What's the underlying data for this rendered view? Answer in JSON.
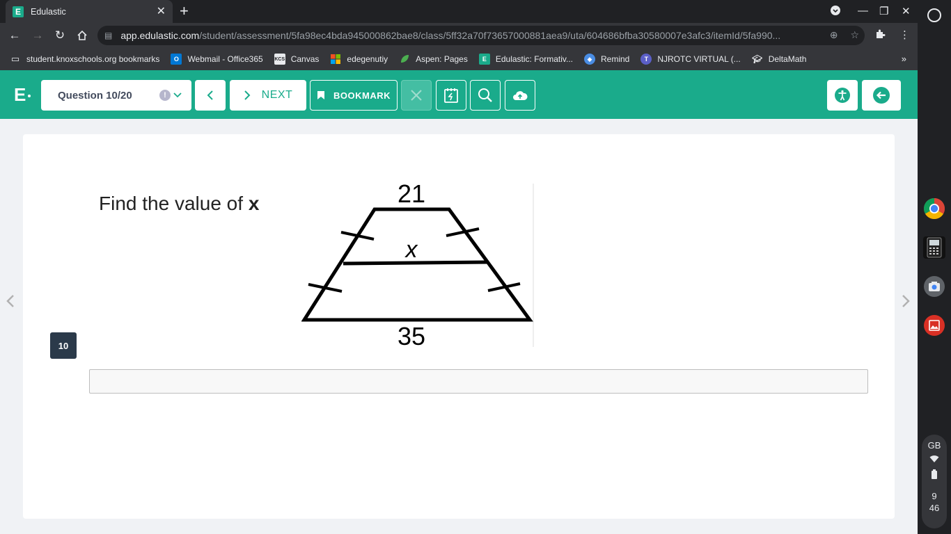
{
  "browser": {
    "tab_title": "Edulastic",
    "tab_favicon_letter": "E",
    "url_host": "app.edulastic.com",
    "url_path": "/student/assessment/5fa98ec4bda945000862bae8/class/5ff32a70f73657000881aea9/uta/604686bfba30580007e3afc3/itemId/5fa990..."
  },
  "bookmarks": [
    {
      "label": "student.knoxschools.org bookmarks",
      "icon": "folder-icon",
      "color": "#5f6368"
    },
    {
      "label": "Webmail - Office365",
      "icon": "outlook-icon",
      "color": "#0078d4"
    },
    {
      "label": "Canvas",
      "icon": "canvas-icon",
      "color": "#e8eaed"
    },
    {
      "label": "edegenutiy",
      "icon": "microsoft-icon",
      "color": "#f25022"
    },
    {
      "label": "Aspen: Pages",
      "icon": "aspen-leaf-icon",
      "color": "#4caf50"
    },
    {
      "label": "Edulastic: Formativ...",
      "icon": "edulastic-icon",
      "color": "#1aab8b"
    },
    {
      "label": "Remind",
      "icon": "remind-icon",
      "color": "#4a8de3"
    },
    {
      "label": "NJROTC VIRTUAL (...",
      "icon": "teams-icon",
      "color": "#5b5fc7"
    },
    {
      "label": "DeltaMath",
      "icon": "grad-cap-icon",
      "color": "#ffffff"
    }
  ],
  "header": {
    "logo_letter": "E",
    "question_label": "Question 10/20",
    "next_label": "NEXT",
    "bookmark_label": "BOOKMARK"
  },
  "question": {
    "number": "10",
    "prompt_text": "Find the value of ",
    "prompt_var": "x",
    "figure": {
      "top_label": "21",
      "middle_label": "x",
      "bottom_label": "35"
    },
    "answer_value": ""
  },
  "tray": {
    "language": "GB",
    "time_hour": "9",
    "time_minute": "46"
  }
}
